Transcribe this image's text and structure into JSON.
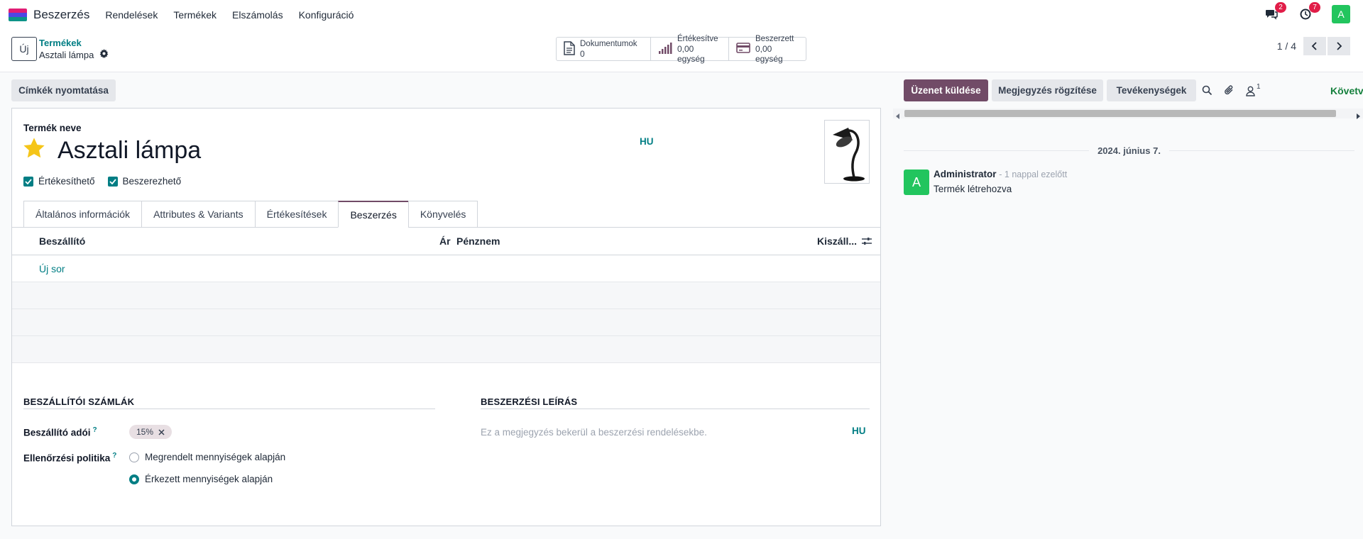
{
  "navbar": {
    "brand": "Beszerzés",
    "menu": [
      "Rendelések",
      "Termékek",
      "Elszámolás",
      "Konfiguráció"
    ],
    "messages_badge": "2",
    "activities_badge": "7",
    "user_initial": "A",
    "logo_colors": [
      "#e11d74",
      "#4f46e5",
      "#0d9488"
    ]
  },
  "control": {
    "new_label": "Új",
    "breadcrumb_parent": "Termékek",
    "breadcrumb_current": "Asztali lámpa",
    "stats": [
      {
        "label": "Dokumentumok",
        "value": "0",
        "icon": "document-icon"
      },
      {
        "label": "Értékesítve",
        "value": "0,00 egység",
        "icon": "bar-chart-icon"
      },
      {
        "label": "Beszerzett",
        "value": "0,00 egység",
        "icon": "credit-card-icon"
      }
    ],
    "pager": "1 / 4"
  },
  "form": {
    "print_label": "Címkék nyomtatása",
    "name_label": "Termék neve",
    "product_name": "Asztali lámpa",
    "lang": "HU",
    "can_sell_label": "Értékesíthető",
    "can_purchase_label": "Beszerezhető",
    "tabs": [
      "Általános információk",
      "Attributes & Variants",
      "Értékesítések",
      "Beszerzés",
      "Könyvelés"
    ],
    "active_tab": "Beszerzés",
    "table": {
      "columns": [
        "Beszállító",
        "Ár",
        "Pénznem",
        "Kiszáll..."
      ],
      "add_line": "Új sor"
    },
    "vendor_bills_title": "BESZÁLLÍTÓI SZÁMLÁK",
    "purchase_desc_title": "BESZERZÉSI LEÍRÁS",
    "vendor_taxes_label": "Beszállító adói",
    "tax_tag": "15%",
    "control_policy_label": "Ellenőrzési politika",
    "policy_options": [
      "Megrendelt mennyiségek alapján",
      "Érkezett mennyiségek alapján"
    ],
    "policy_selected": 1,
    "desc_placeholder": "Ez a megjegyzés bekerül a beszerzési rendelésekbe.",
    "desc_lang": "HU",
    "help_mark": "?"
  },
  "chatter": {
    "send_message": "Üzenet küldése",
    "log_note": "Megjegyzés rögzítése",
    "activities": "Tevékenységek",
    "followers_count": "1",
    "follow_label": "Követve",
    "date": "2024. június 7.",
    "message": {
      "author_initial": "A",
      "author": "Administrator",
      "time": "- 1 nappal ezelőtt",
      "body": "Termék létrehozva"
    }
  },
  "colors": {
    "primary": "#714b67",
    "accent": "#017e84",
    "avatar": "#22c55e",
    "badge": "#e11d48"
  }
}
